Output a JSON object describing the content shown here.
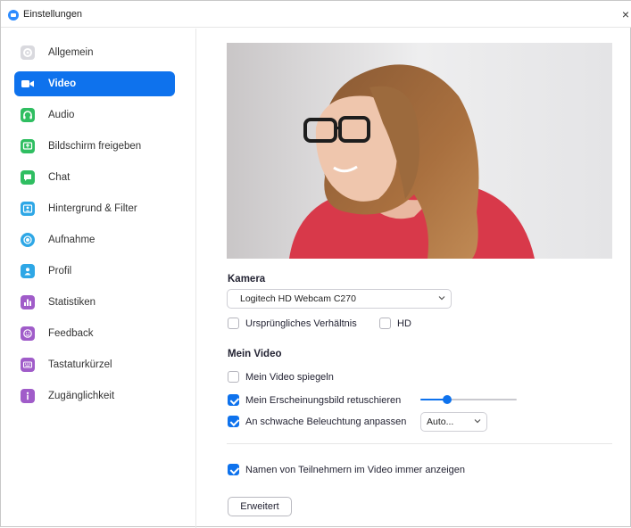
{
  "window": {
    "title": "Einstellungen",
    "close_glyph": "×"
  },
  "sidebar": {
    "items": [
      {
        "label": "Allgemein",
        "icon": "gear-icon",
        "color": "#c9c9cf"
      },
      {
        "label": "Video",
        "icon": "video-camera-icon",
        "color": "#ffffff",
        "active": true
      },
      {
        "label": "Audio",
        "icon": "headphones-icon",
        "color": "#2fbe61"
      },
      {
        "label": "Bildschirm freigeben",
        "icon": "share-screen-icon",
        "color": "#2fbe61"
      },
      {
        "label": "Chat",
        "icon": "chat-bubble-icon",
        "color": "#2fbe61"
      },
      {
        "label": "Hintergrund & Filter",
        "icon": "background-icon",
        "color": "#2ea7e6"
      },
      {
        "label": "Aufnahme",
        "icon": "record-icon",
        "color": "#2ea7e6"
      },
      {
        "label": "Profil",
        "icon": "profile-icon",
        "color": "#2ea7e6"
      },
      {
        "label": "Statistiken",
        "icon": "statistics-icon",
        "color": "#a05cc9"
      },
      {
        "label": "Feedback",
        "icon": "feedback-smiley-icon",
        "color": "#a05cc9"
      },
      {
        "label": "Tastaturkürzel",
        "icon": "keyboard-icon",
        "color": "#a05cc9"
      },
      {
        "label": "Zugänglichkeit",
        "icon": "accessibility-icon",
        "color": "#a05cc9"
      }
    ]
  },
  "video": {
    "camera_heading": "Kamera",
    "camera_selected": "Logitech HD Webcam C270",
    "original_ratio_label": "Ursprüngliches Verhältnis",
    "original_ratio_checked": false,
    "hd_label": "HD",
    "hd_checked": false,
    "my_video_heading": "Mein Video",
    "mirror_label": "Mein Video spiegeln",
    "mirror_checked": false,
    "touchup_label": "Mein Erscheinungsbild retuschieren",
    "touchup_checked": true,
    "touchup_level": 0.28,
    "lowlight_label": "An schwache Beleuchtung anpassen",
    "lowlight_checked": true,
    "lowlight_mode": "Auto...",
    "show_names_label": "Namen von Teilnehmern im Video immer anzeigen",
    "show_names_checked": true,
    "advanced_button": "Erweitert"
  },
  "colors": {
    "accent": "#0e72ed"
  }
}
